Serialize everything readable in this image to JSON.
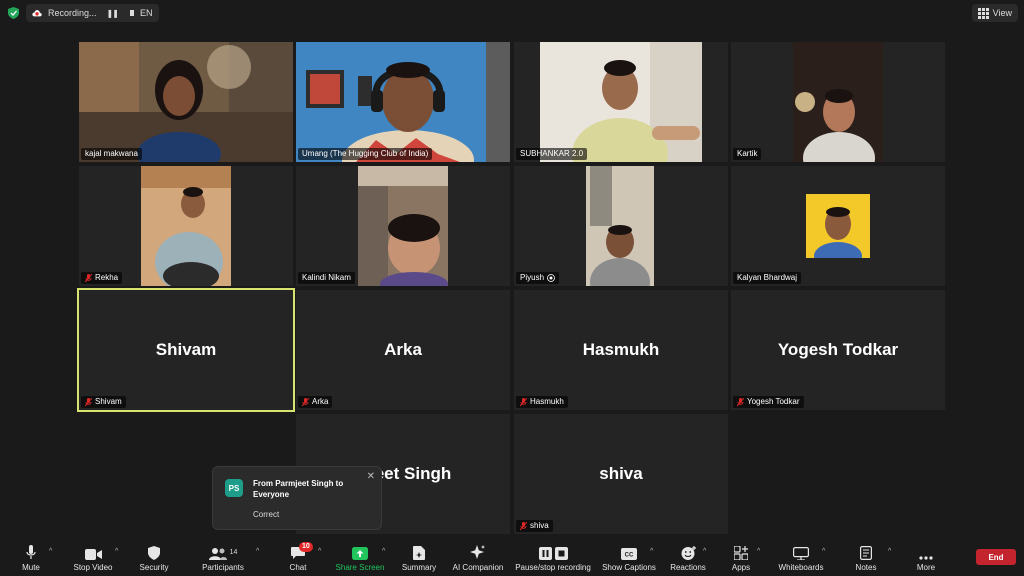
{
  "topbar": {
    "recording_label": "Recording...",
    "language": "EN",
    "view_label": "View"
  },
  "tiles": [
    {
      "name": "kajal makwana"
    },
    {
      "name": "Umang (The Hugging Club of India)"
    },
    {
      "name": "SUBHANKAR 2.0"
    },
    {
      "name": "Kartik"
    },
    {
      "name": "Rekha"
    },
    {
      "name": "Kalindi Nikam"
    },
    {
      "name": "Piyush"
    },
    {
      "name": "Kalyan Bhardwaj"
    },
    {
      "name": "Shivam",
      "display": "Shivam"
    },
    {
      "name": "Arka",
      "display": "Arka"
    },
    {
      "name": "Hasmukh",
      "display": "Hasmukh"
    },
    {
      "name": "Yogesh Todkar",
      "display": "Yogesh Todkar"
    },
    {
      "display": "jeet Singh"
    },
    {
      "name": "shiva",
      "display": "shiva"
    }
  ],
  "chat_toast": {
    "initials": "PS",
    "from": "From Parmjeet Singh to Everyone",
    "message": "Correct"
  },
  "toolbar": {
    "mute": "Mute",
    "stop_video": "Stop Video",
    "security": "Security",
    "participants": "Participants",
    "participants_count": "14",
    "chat": "Chat",
    "chat_badge": "10",
    "share_screen": "Share Screen",
    "summary": "Summary",
    "ai_companion": "AI Companion",
    "pause_recording": "Pause/stop recording",
    "show_captions": "Show Captions",
    "reactions": "Reactions",
    "apps": "Apps",
    "whiteboards": "Whiteboards",
    "notes": "Notes",
    "more": "More",
    "end": "End"
  },
  "colors": {
    "active_border": "#d8e46e",
    "share_green": "#21c45d",
    "end_red": "#c4242d",
    "badge_red": "#e02828"
  }
}
